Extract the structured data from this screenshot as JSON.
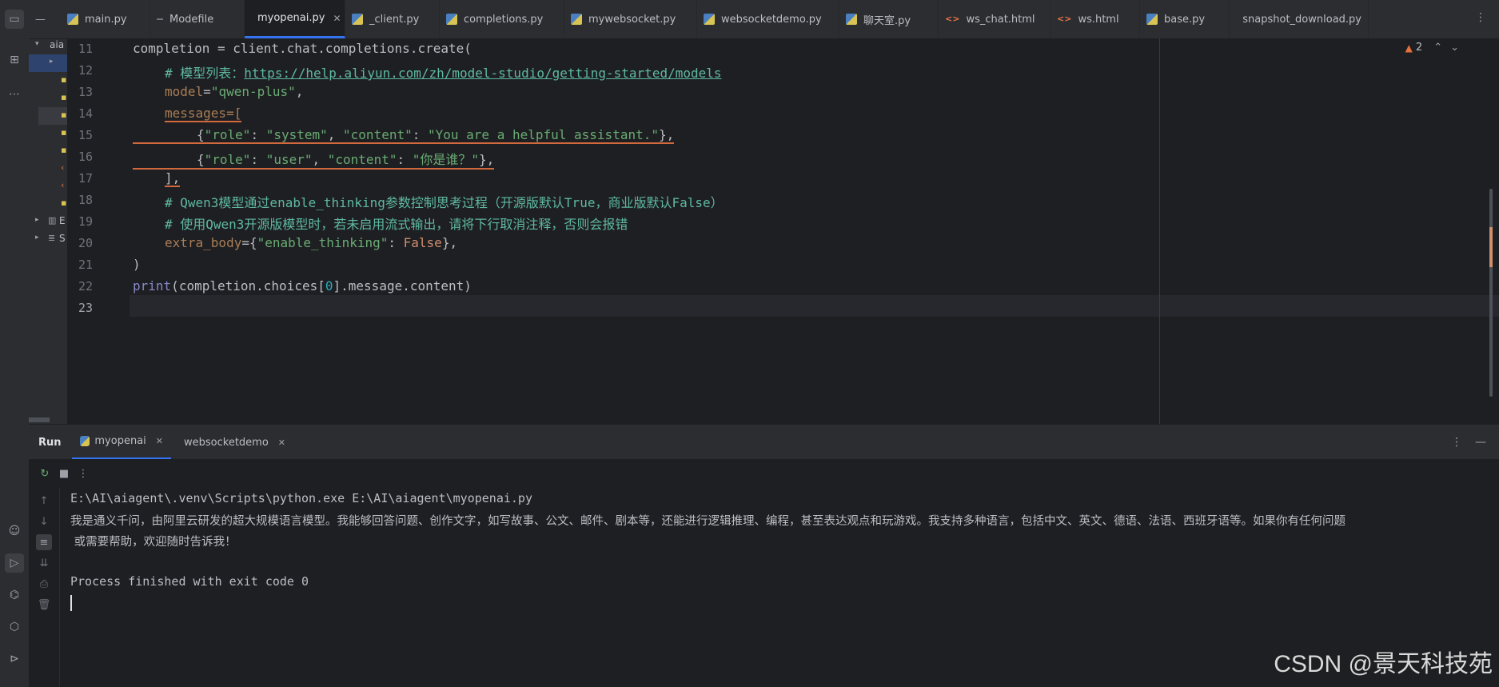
{
  "tabs": [
    {
      "label": "main.py",
      "icon": "python-file-icon",
      "active": false
    },
    {
      "label": "Modefile",
      "icon": "text-file-icon",
      "active": false
    },
    {
      "label": "myopenai.py",
      "icon": "python-file-icon",
      "active": true
    },
    {
      "label": "_client.py",
      "icon": "python-file-icon",
      "active": false
    },
    {
      "label": "completions.py",
      "icon": "python-file-icon",
      "active": false
    },
    {
      "label": "mywebsocket.py",
      "icon": "python-file-icon",
      "active": false
    },
    {
      "label": "websocketdemo.py",
      "icon": "python-file-icon",
      "active": false
    },
    {
      "label": "聊天室.py",
      "icon": "python-file-icon",
      "active": false
    },
    {
      "label": "ws_chat.html",
      "icon": "html-file-icon",
      "active": false
    },
    {
      "label": "ws.html",
      "icon": "html-file-icon",
      "active": false
    },
    {
      "label": "base.py",
      "icon": "python-file-icon",
      "active": false
    },
    {
      "label": "snapshot_download.py",
      "icon": "python-file-icon",
      "active": false
    }
  ],
  "project": {
    "root_label": "aia",
    "tree_label_e": "E",
    "tree_label_s": "S"
  },
  "editor": {
    "warning_count": "2",
    "line_numbers": [
      "11",
      "12",
      "13",
      "14",
      "15",
      "16",
      "17",
      "18",
      "19",
      "20",
      "21",
      "22",
      "23"
    ],
    "lines": {
      "l11_a": "completion",
      "l11_b": " = ",
      "l11_c": "client",
      "l11_d": ".",
      "l11_e": "chat",
      "l11_f": ".",
      "l11_g": "completions",
      "l11_h": ".",
      "l11_i": "create",
      "l11_j": "(",
      "l12_cm": "# 模型列表：",
      "l12_link": "https://help.aliyun.com/zh/model-studio/getting-started/models",
      "l13_p": "model",
      "l13_eq": "=",
      "l13_s": "\"qwen-plus\"",
      "l13_c": ",",
      "l14_p": "messages=[",
      "l15_a": "{",
      "l15_k1": "\"role\"",
      "l15_c1": ": ",
      "l15_v1": "\"system\"",
      "l15_c2": ", ",
      "l15_k2": "\"content\"",
      "l15_c3": ": ",
      "l15_v2": "\"You are a helpful assistant.\"",
      "l15_end": "},",
      "l16_a": "{",
      "l16_k1": "\"role\"",
      "l16_c1": ": ",
      "l16_v1": "\"user\"",
      "l16_c2": ", ",
      "l16_k2": "\"content\"",
      "l16_c3": ": ",
      "l16_v2": "\"你是谁？\"",
      "l16_end": "},",
      "l17": "],",
      "l18_cm": "# Qwen3模型通过enable_thinking参数控制思考过程（开源版默认True，商业版默认False）",
      "l19_cm": "# 使用Qwen3开源版模型时，若未启用流式输出，请将下行取消注释，否则会报错",
      "l20_p": "extra_body",
      "l20_eq": "=",
      "l20_a": "{",
      "l20_k": "\"enable_thinking\"",
      "l20_c": ": ",
      "l20_v": "False",
      "l20_end": "},",
      "l21": ")",
      "l22_fn": "print",
      "l22_a": "(",
      "l22_b": "completion",
      "l22_c": ".",
      "l22_d": "choices",
      "l22_e": "[",
      "l22_n": "0",
      "l22_f": "]",
      "l22_g": ".",
      "l22_h": "message",
      "l22_i": ".",
      "l22_j": "content",
      "l22_k": ")"
    }
  },
  "run": {
    "title": "Run",
    "tabs": [
      {
        "label": "myopenai",
        "active": true
      },
      {
        "label": "websocketdemo",
        "active": false
      }
    ],
    "output": [
      "E:\\AI\\aiagent\\.venv\\Scripts\\python.exe E:\\AI\\aiagent\\myopenai.py",
      "我是通义千问，由阿里云研发的超大规模语言模型。我能够回答问题、创作文字，如写故事、公文、邮件、剧本等，还能进行逻辑推理、编程，甚至表达观点和玩游戏。我支持多种语言，包括中文、英文、德语、法语、西班牙语等。如果你有任何问题",
      " 或需要帮助，欢迎随时告诉我！",
      "",
      "Process finished with exit code 0"
    ]
  },
  "watermark": "CSDN @景天科技苑"
}
